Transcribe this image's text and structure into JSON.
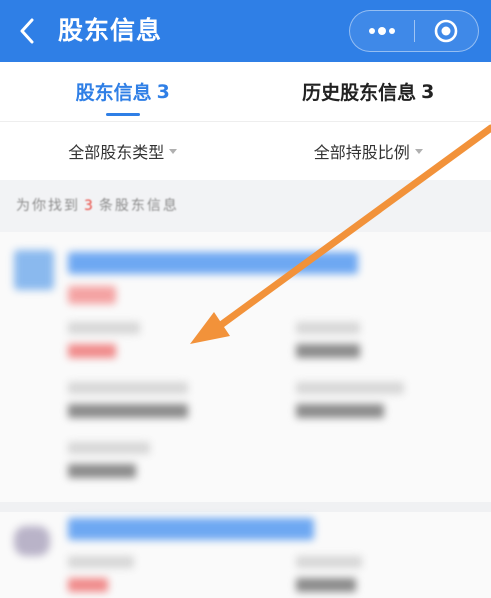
{
  "colors": {
    "brand": "#2f7fe6",
    "accent": "#e8453c",
    "arrow": "#f2923a"
  },
  "header": {
    "title": "股东信息",
    "back_icon": "chevron-left-icon",
    "more_icon": "more-dots-icon",
    "close_icon": "target-close-icon"
  },
  "tabs": [
    {
      "label": "股东信息",
      "count": "3",
      "active": true
    },
    {
      "label": "历史股东信息",
      "count": "3",
      "active": false
    }
  ],
  "filters": [
    {
      "label": "全部股东类型"
    },
    {
      "label": "全部持股比例"
    }
  ],
  "summary": {
    "prefix": "为你找到",
    "count": "3",
    "suffix": "条股东信息"
  }
}
